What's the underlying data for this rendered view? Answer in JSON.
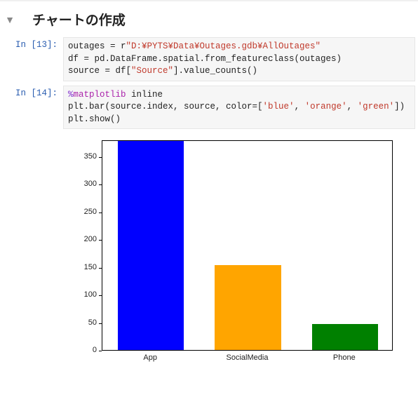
{
  "section": {
    "title": "チャートの作成"
  },
  "cells": {
    "c1": {
      "prompt": "In [13]:",
      "code": {
        "line1a": "outages = r",
        "line1b": "\"D:¥PYTS¥Data¥Outages.gdb¥AllOutages\"",
        "line2": "df = pd.DataFrame.spatial.from_featureclass(outages)",
        "line3a": "source = df[",
        "line3b": "\"Source\"",
        "line3c": "].value_counts()"
      }
    },
    "c2": {
      "prompt": "In [14]:",
      "code": {
        "line1a": "%",
        "line1b": "matplotlib",
        "line1c": " inline",
        "line2a": "plt.bar(source.index, source, color=[",
        "line2b": "'blue'",
        "line2c": ", ",
        "line2d": "'orange'",
        "line2e": ", ",
        "line2f": "'green'",
        "line2g": "])",
        "line3": "plt.show()"
      }
    }
  },
  "chart_data": {
    "type": "bar",
    "categories": [
      "App",
      "SocialMedia",
      "Phone"
    ],
    "values": [
      377,
      153,
      47
    ],
    "colors": [
      "#0000ff",
      "#ffa500",
      "#008000"
    ],
    "title": "",
    "xlabel": "",
    "ylabel": "",
    "ylim": [
      0,
      380
    ],
    "yticks": [
      0,
      50,
      100,
      150,
      200,
      250,
      300,
      350
    ]
  }
}
